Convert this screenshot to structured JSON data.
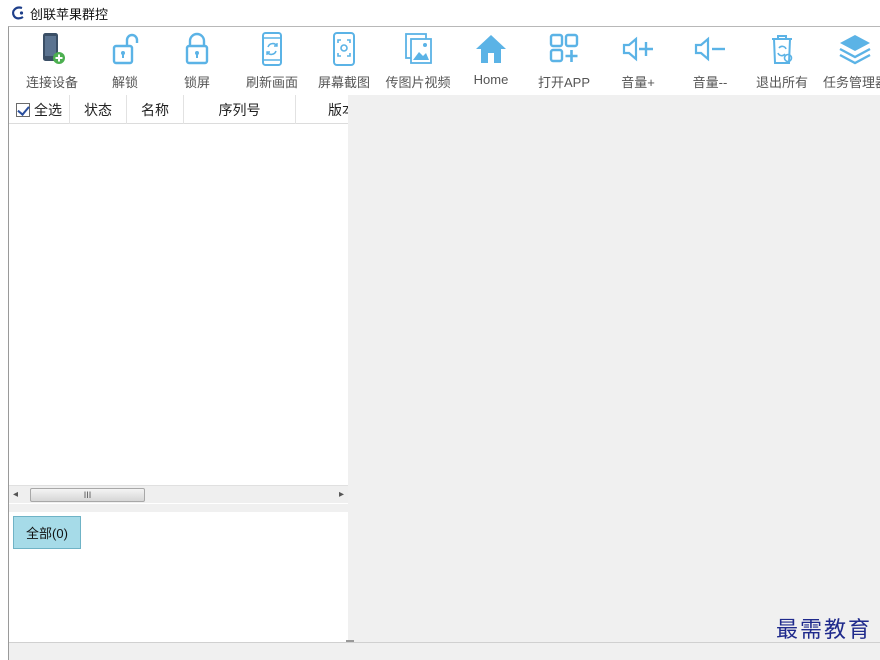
{
  "window": {
    "title": "创联苹果群控"
  },
  "colors": {
    "icon_blue": "#5bb3e6",
    "icon_dark": "#3b4f66",
    "icon_green": "#4caf50",
    "all_button_bg": "#a6dbe8"
  },
  "toolbar": {
    "items": [
      {
        "label": "连接设备",
        "icon": "phone-add-icon"
      },
      {
        "label": "解锁",
        "icon": "unlock-icon"
      },
      {
        "label": "锁屏",
        "icon": "lock-icon"
      },
      {
        "label": "刷新画面",
        "icon": "refresh-screen-icon"
      },
      {
        "label": "屏幕截图",
        "icon": "screenshot-icon"
      },
      {
        "label": "传图片视频",
        "icon": "images-icon"
      },
      {
        "label": "Home",
        "icon": "home-icon"
      },
      {
        "label": "打开APP",
        "icon": "apps-icon"
      },
      {
        "label": "音量+",
        "icon": "volume-up-icon"
      },
      {
        "label": "音量--",
        "icon": "volume-down-icon"
      },
      {
        "label": "退出所有",
        "icon": "trash-icon"
      },
      {
        "label": "任务管理器",
        "icon": "layers-icon"
      }
    ]
  },
  "device_table": {
    "select_all_label": "全选",
    "select_all_checked": true,
    "columns": [
      "状态",
      "名称",
      "序列号",
      "版本"
    ]
  },
  "scrollbar": {
    "thumb_glyph": "III",
    "left_arrow": "◂",
    "right_arrow": "▸"
  },
  "groups": {
    "all_button_label": "全部(0)"
  },
  "watermark": "最需教育"
}
